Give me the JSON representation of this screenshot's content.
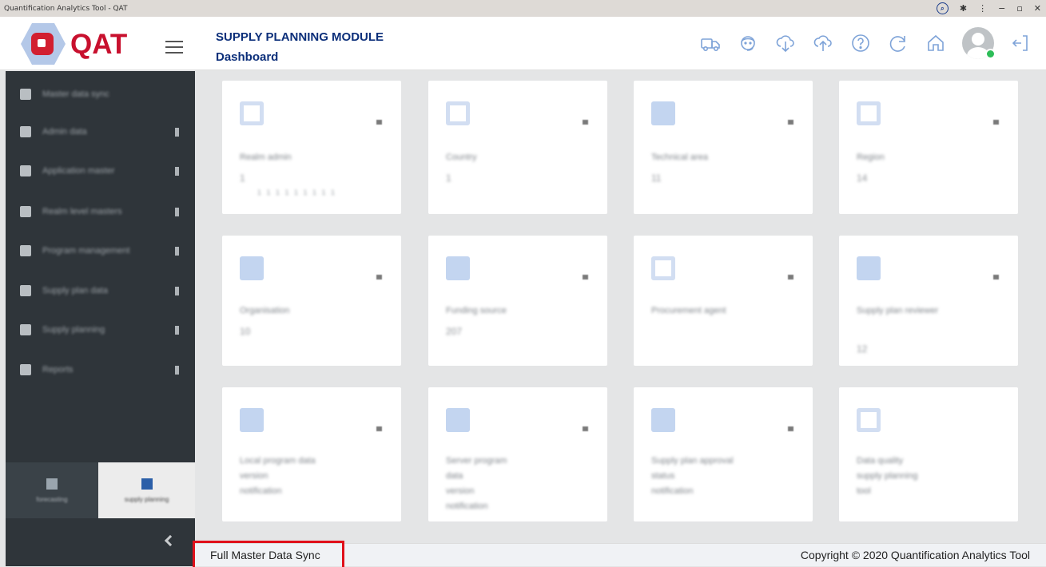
{
  "window": {
    "title": "Quantification Analytics Tool - QAT",
    "controls": [
      "zoom-icon",
      "extensions-icon",
      "menu-icon",
      "minimize",
      "restore",
      "close"
    ]
  },
  "header": {
    "logo_text": "QAT",
    "module_title": "SUPPLY PLANNING MODULE",
    "page_title": "Dashboard",
    "icons": [
      "truck-icon",
      "support-agent-icon",
      "cloud-download-icon",
      "cloud-upload-icon",
      "help-icon",
      "refresh-icon",
      "home-icon",
      "user-avatar",
      "logout-icon"
    ],
    "accent_color": "#0c2f7a",
    "brand_color": "#c8102e"
  },
  "sidebar": {
    "items": [
      {
        "label": "Master data sync",
        "has_arrow": false
      },
      {
        "label": "Admin data",
        "has_arrow": true
      },
      {
        "label": "Application master",
        "has_arrow": true
      },
      {
        "label": "Realm level masters",
        "has_arrow": true
      },
      {
        "label": "Program management",
        "has_arrow": true
      },
      {
        "label": "Supply plan data",
        "has_arrow": true
      },
      {
        "label": "Supply planning",
        "has_arrow": true
      },
      {
        "label": "Reports",
        "has_arrow": true
      }
    ],
    "tabs": [
      {
        "label": "forecasting"
      },
      {
        "label": "supply planning"
      }
    ]
  },
  "cards": [
    {
      "title": "Realm admin",
      "value": "1",
      "sub": "1 1 1 1 1 1 1 1 1"
    },
    {
      "title": "Country",
      "value": "1",
      "sub": ""
    },
    {
      "title": "Technical area",
      "value": "11",
      "sub": ""
    },
    {
      "title": "Region",
      "value": "14",
      "sub": ""
    },
    {
      "title": "Organisation",
      "value": "10",
      "sub": ""
    },
    {
      "title": "Funding source",
      "value": "207",
      "sub": ""
    },
    {
      "title": "Procurement agent",
      "value": "",
      "sub": ""
    },
    {
      "title": "Supply plan reviewer",
      "value": "12",
      "sub": ""
    },
    {
      "title": "Local program data\nversion\nnotification",
      "value": "",
      "sub": ""
    },
    {
      "title": "Server program\ndata\nversion\nnotification",
      "value": "",
      "sub": ""
    },
    {
      "title": "Supply plan approval\nstatus\nnotification",
      "value": "",
      "sub": ""
    },
    {
      "title": "Data quality\nsupply planning\ntool",
      "value": "",
      "sub": ""
    }
  ],
  "footer": {
    "sync_label": "Full Master Data Sync",
    "copyright": "Copyright © 2020 Quantification Analytics Tool"
  }
}
